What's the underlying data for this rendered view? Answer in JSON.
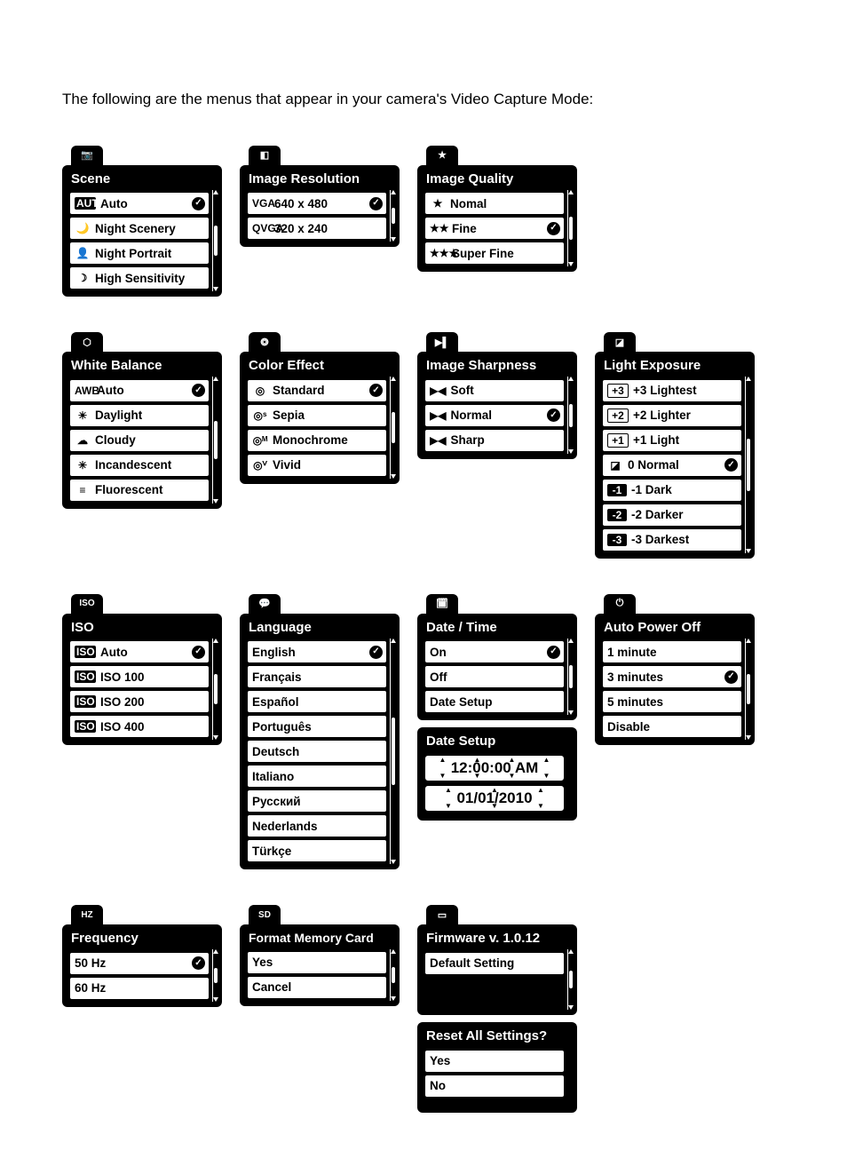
{
  "intro_text": "The following are the menus that appear in your camera's Video Capture Mode:",
  "check_glyph": "✓",
  "tab_icons": {
    "scene": "📷",
    "resolution": "◧",
    "quality": "★",
    "wb": "⬡",
    "color": "❂",
    "sharpness": "▶▌",
    "exposure": "◪",
    "iso": "ISO",
    "language": "💬",
    "datetime": "🗓",
    "power": "⏻",
    "freq": "HZ",
    "format": "SD",
    "firmware": "▭"
  },
  "menus": {
    "scene": {
      "title": "Scene",
      "items": [
        {
          "icon": "AUTO",
          "iconClass": "icon-badge",
          "label": "Auto",
          "selected": true
        },
        {
          "icon": "🌙",
          "label": "Night Scenery"
        },
        {
          "icon": "👤",
          "label": "Night Portrait"
        },
        {
          "icon": "☽",
          "label": "High Sensitivity"
        }
      ]
    },
    "resolution": {
      "title": "Image Resolution",
      "items": [
        {
          "icon": "VGA",
          "iconClass": "",
          "label": "640 x 480",
          "selected": true
        },
        {
          "icon": "QVGA",
          "iconClass": "",
          "label": "320 x 240"
        }
      ]
    },
    "quality": {
      "title": "Image Quality",
      "items": [
        {
          "icon": "★",
          "label": "Nomal"
        },
        {
          "icon": "★★",
          "label": "Fine",
          "selected": true
        },
        {
          "icon": "★★★",
          "label": "Super Fine"
        }
      ]
    },
    "wb": {
      "title": "White Balance",
      "items": [
        {
          "icon": "AWB",
          "iconClass": "",
          "label": "Auto",
          "selected": true
        },
        {
          "icon": "☀",
          "label": "Daylight"
        },
        {
          "icon": "☁",
          "label": "Cloudy"
        },
        {
          "icon": "✳",
          "label": "Incandescent"
        },
        {
          "icon": "≡",
          "label": "Fluorescent"
        }
      ]
    },
    "color": {
      "title": "Color Effect",
      "items": [
        {
          "icon": "◎",
          "label": "Standard",
          "selected": true
        },
        {
          "icon": "◎ˢ",
          "label": "Sepia"
        },
        {
          "icon": "◎ᴹ",
          "label": "Monochrome"
        },
        {
          "icon": "◎ⱽ",
          "label": "Vivid"
        }
      ]
    },
    "sharpness": {
      "title": "Image Sharpness",
      "items": [
        {
          "icon": "▶◀",
          "label": "Soft"
        },
        {
          "icon": "▶◀",
          "label": "Normal",
          "selected": true
        },
        {
          "icon": "▶◀",
          "label": "Sharp"
        }
      ]
    },
    "exposure": {
      "title": "Light Exposure",
      "items": [
        {
          "icon": "+3",
          "iconClass": "icon-badge inverse",
          "label": "+3 Lightest"
        },
        {
          "icon": "+2",
          "iconClass": "icon-badge inverse",
          "label": "+2 Lighter"
        },
        {
          "icon": "+1",
          "iconClass": "icon-badge inverse",
          "label": "+1 Light"
        },
        {
          "icon": "◪",
          "label": "0 Normal",
          "selected": true
        },
        {
          "icon": "-1",
          "iconClass": "icon-badge",
          "label": "-1 Dark"
        },
        {
          "icon": "-2",
          "iconClass": "icon-badge",
          "label": "-2 Darker"
        },
        {
          "icon": "-3",
          "iconClass": "icon-badge",
          "label": "-3 Darkest"
        }
      ]
    },
    "iso": {
      "title": "ISO",
      "items": [
        {
          "icon": "ISO",
          "iconClass": "icon-badge",
          "label": "Auto",
          "selected": true
        },
        {
          "icon": "ISO",
          "iconClass": "icon-badge",
          "label": "ISO 100"
        },
        {
          "icon": "ISO",
          "iconClass": "icon-badge",
          "label": "ISO 200"
        },
        {
          "icon": "ISO",
          "iconClass": "icon-badge",
          "label": "ISO 400"
        }
      ]
    },
    "language": {
      "title": "Language",
      "items": [
        {
          "label": "English",
          "selected": true
        },
        {
          "label": "Français"
        },
        {
          "label": "Español"
        },
        {
          "label": "Português"
        },
        {
          "label": "Deutsch"
        },
        {
          "label": "Italiano"
        },
        {
          "label": "Русский"
        },
        {
          "label": "Nederlands"
        },
        {
          "label": "Türkçe"
        }
      ]
    },
    "datetime": {
      "title": "Date / Time",
      "items": [
        {
          "label": "On",
          "selected": true
        },
        {
          "label": "Off"
        },
        {
          "label": "Date Setup"
        }
      ]
    },
    "datesetup": {
      "title": "Date Setup",
      "time_value": "12:00:00 AM",
      "date_value": "01/01/2010"
    },
    "power": {
      "title": "Auto Power Off",
      "items": [
        {
          "label": "1 minute"
        },
        {
          "label": "3 minutes",
          "selected": true
        },
        {
          "label": "5 minutes"
        },
        {
          "label": "Disable"
        }
      ]
    },
    "frequency": {
      "title": "Frequency",
      "items": [
        {
          "label": "50 Hz",
          "selected": true
        },
        {
          "label": "60 Hz"
        }
      ]
    },
    "format": {
      "title": "Format Memory Card",
      "items": [
        {
          "label": "Yes"
        },
        {
          "label": "Cancel"
        }
      ]
    },
    "firmware": {
      "title": "Firmware v. 1.0.12",
      "items": [
        {
          "label": "Default Setting"
        }
      ]
    },
    "reset": {
      "title": "Reset All Settings?",
      "items": [
        {
          "label": "Yes"
        },
        {
          "label": "No"
        }
      ]
    }
  }
}
